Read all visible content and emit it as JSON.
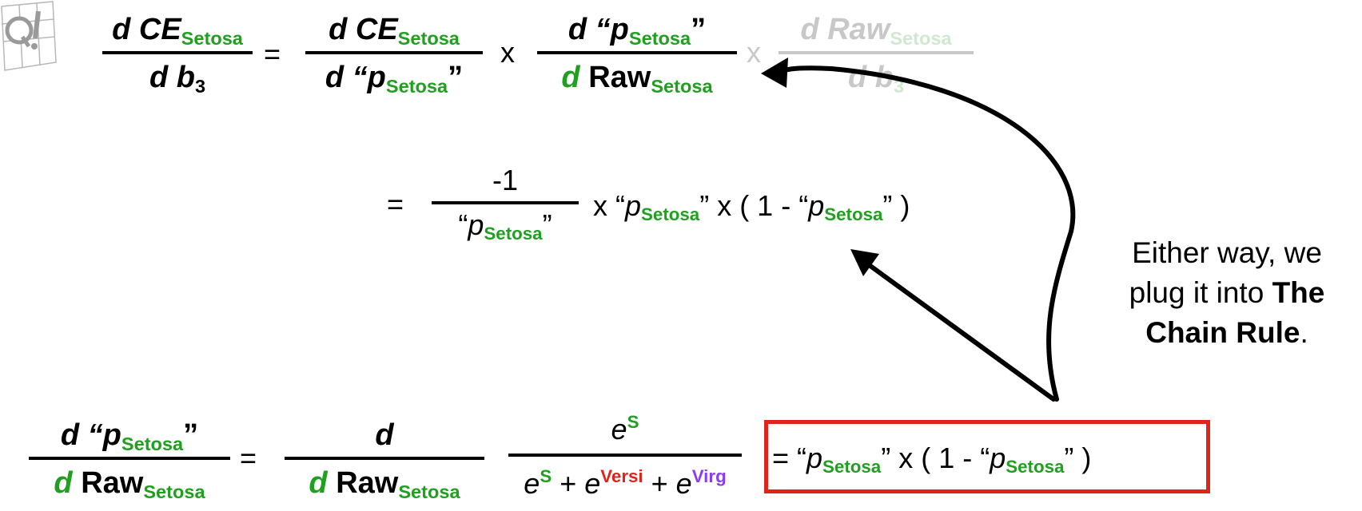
{
  "logo": {
    "alt": "StatQuest logo"
  },
  "colors": {
    "green": "#1fa01f",
    "red": "#e0231b",
    "purple": "#8a3cf0",
    "faded": "#c8c8c8"
  },
  "top_eq": {
    "lhs_num": "d CE",
    "lhs_num_sub": "Setosa",
    "lhs_den": "d b",
    "lhs_den_sub": "3",
    "eq": "=",
    "t1_num": "d CE",
    "t1_num_sub": "Setosa",
    "t1_den_d": "d",
    "t1_den_p": "“p",
    "t1_den_sub": "Setosa",
    "t1_den_close": "”",
    "times1": "x",
    "t2_num_d": "d",
    "t2_num_p": "“p",
    "t2_num_sub": "Setosa",
    "t2_num_close": "”",
    "t2_den_d": "d",
    "t2_den_raw": "Raw",
    "t2_den_sub": "Setosa",
    "times2": "x",
    "t3_num": "d Raw",
    "t3_num_sub": "Setosa",
    "t3_den": "d b",
    "t3_den_sub": "3"
  },
  "mid_eq": {
    "eq": "=",
    "num": "-1",
    "den_open": "“",
    "den_p": "p",
    "den_sub": "Setosa",
    "den_close": "”",
    "rest_times": "x “",
    "rest_p1": "p",
    "rest_sub1": "Setosa",
    "rest_mid": "” x ( 1 - “",
    "rest_p2": "p",
    "rest_sub2": "Setosa",
    "rest_close": "” )"
  },
  "note": {
    "line1": "Either way, we",
    "line2": "plug it into",
    "bold1": "The",
    "bold2": "Chain Rule",
    "end": "."
  },
  "bottom_eq": {
    "lhs_num_d": "d",
    "lhs_num_p": "“p",
    "lhs_num_sub": "Setosa",
    "lhs_num_close": "”",
    "lhs_den_d": "d",
    "lhs_den_raw": "Raw",
    "lhs_den_sub": "Setosa",
    "eq": "=",
    "op_num": "d",
    "op_den_d": "d",
    "op_den_raw": "Raw",
    "op_den_sub": "Setosa",
    "soft_num_e": "e",
    "soft_num_sup": "S",
    "soft_den_e1": "e",
    "soft_den_sup1": "S",
    "soft_den_plus1": " + ",
    "soft_den_e2": "e",
    "soft_den_sup2": "Versi",
    "soft_den_plus2": " + ",
    "soft_den_e3": "e",
    "soft_den_sup3": "Virg",
    "result_open": "= “",
    "result_p1": "p",
    "result_sub1": "Setosa",
    "result_mid": "” x ( 1 - “",
    "result_p2": "p",
    "result_sub2": "Setosa",
    "result_close": "” )"
  }
}
